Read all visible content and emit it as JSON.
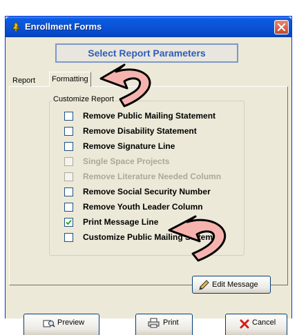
{
  "window": {
    "title": "Enrollment Forms"
  },
  "header": {
    "title": "Select Report Parameters"
  },
  "tabs": [
    {
      "label": "Report"
    },
    {
      "label": "Formatting"
    }
  ],
  "group": {
    "label": "Customize Report",
    "options": [
      {
        "label": "Remove Public Mailing Statement",
        "checked": false,
        "enabled": true
      },
      {
        "label": "Remove Disability Statement",
        "checked": false,
        "enabled": true
      },
      {
        "label": "Remove Signature Line",
        "checked": false,
        "enabled": true
      },
      {
        "label": "Single Space Projects",
        "checked": false,
        "enabled": false
      },
      {
        "label": "Remove Literature Needed Column",
        "checked": false,
        "enabled": false
      },
      {
        "label": "Remove Social Security Number",
        "checked": false,
        "enabled": true
      },
      {
        "label": "Remove Youth Leader Column",
        "checked": false,
        "enabled": true
      },
      {
        "label": "Print Message Line",
        "checked": true,
        "enabled": true
      },
      {
        "label": "Customize Public Mailing Statement",
        "checked": false,
        "enabled": true
      }
    ]
  },
  "buttons": {
    "edit_message": "Edit Message",
    "preview": "Preview",
    "print": "Print",
    "cancel": "Cancel"
  },
  "colors": {
    "titlebar": "#0a53d6",
    "header_text": "#2f5cb8",
    "arrow_fill": "#f6b3ae",
    "cancel_icon": "#d0201a"
  },
  "icons": {
    "app": "tree-icon",
    "close": "close-icon",
    "edit": "pencil-icon",
    "preview": "preview-icon",
    "print": "printer-icon",
    "cancel": "red-x-icon",
    "annotation": "curved-arrow"
  }
}
